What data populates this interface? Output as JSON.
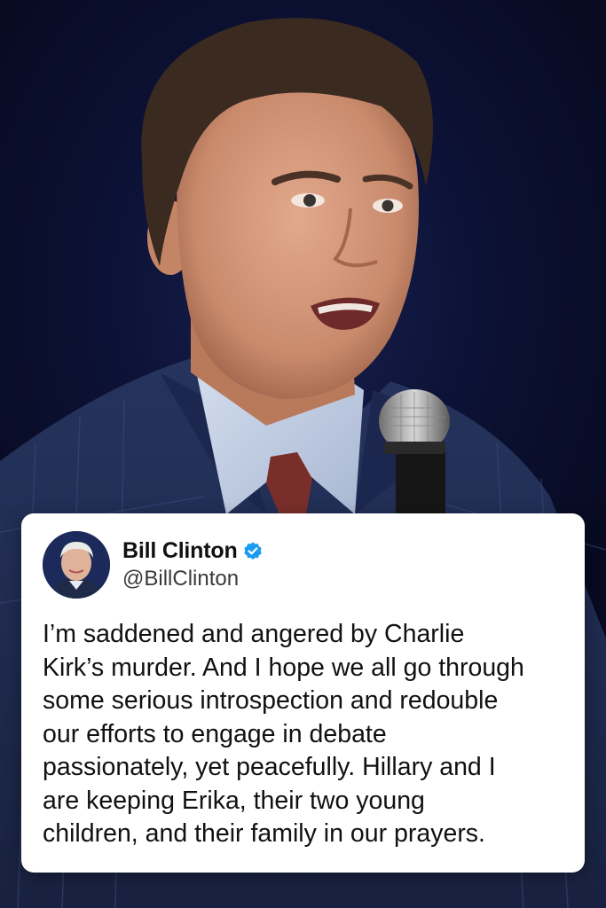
{
  "tweet": {
    "display_name": "Bill Clinton",
    "handle": "@BillClinton",
    "verified": true,
    "verified_icon": "verified-badge-icon",
    "verified_color": "#1d9bf0",
    "text": "I’m saddened and angered by Charlie\nKirk’s murder. And I hope we all go through\nsome serious introspection and redouble\nour efforts to engage in debate\npassionately, yet peacefully. Hillary and I\nare keeping Erika, their two young\nchildren, and their family in our prayers."
  },
  "background": {
    "subject": "speaker-with-microphone-photo",
    "backdrop_color": "#0a0e2a"
  }
}
